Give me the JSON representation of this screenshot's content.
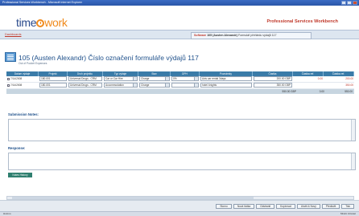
{
  "window": {
    "title": "Professional Services Workbench - Microsoft Internet Explorer"
  },
  "header": {
    "logo_pre": "time",
    "logo_post": "work",
    "app_title": "Professional Services Workbench"
  },
  "nav": {
    "home_link": "Dashboards",
    "tab_prefix": "Software",
    "tab_title": "105 (Austen Alexandr)",
    "tab_suffix": "Formulář přehledu výdajů 117"
  },
  "form": {
    "title": "105 (Austen Alexandr)  Číslo označení formuláře výdajů 117",
    "subtitle": "Out of Pocket Expenses"
  },
  "grid": {
    "columns": [
      "Datum výdaje",
      "Projekt",
      "Druh projektu",
      "Typ výdaje",
      "Stav",
      "DPH",
      "Poznámky",
      "Částka",
      "Částka ref.",
      "Částka ref."
    ],
    "rows": [
      {
        "date": "7/14/2008",
        "project": "180-001",
        "proj_type": "Universal Drugs - CRM",
        "exp_type": "Car or Car Hire",
        "status": "Charge",
        "vat": "0%",
        "notes": "Avis car rental 3days",
        "amount": "200.00 GBP",
        "ref1": "0.00",
        "ref2": "200.00"
      },
      {
        "date": "7/14/2008",
        "project": "180-001",
        "proj_type": "Universal Drugs - CRM",
        "exp_type": "Accommodation",
        "status": "Charge",
        "vat": "",
        "notes": "hotel 4nights",
        "amount": "350.00 GBP",
        "ref1": "",
        "ref2": "350.00"
      }
    ],
    "totals": {
      "amount": "550.00 GBP",
      "ref1": "0.00",
      "ref2": "550.00"
    }
  },
  "submission": {
    "label": "Submission Notes:"
  },
  "response": {
    "label": "Response:"
  },
  "notes_button": "Notes History",
  "buttons": [
    "Storno",
    "Nová řádka",
    "Odstranit",
    "Kopírovat",
    "Uložit & Nový",
    "Předložit",
    "Tisk"
  ],
  "status": {
    "left": "Hotovo",
    "right": "Místní intranet"
  }
}
